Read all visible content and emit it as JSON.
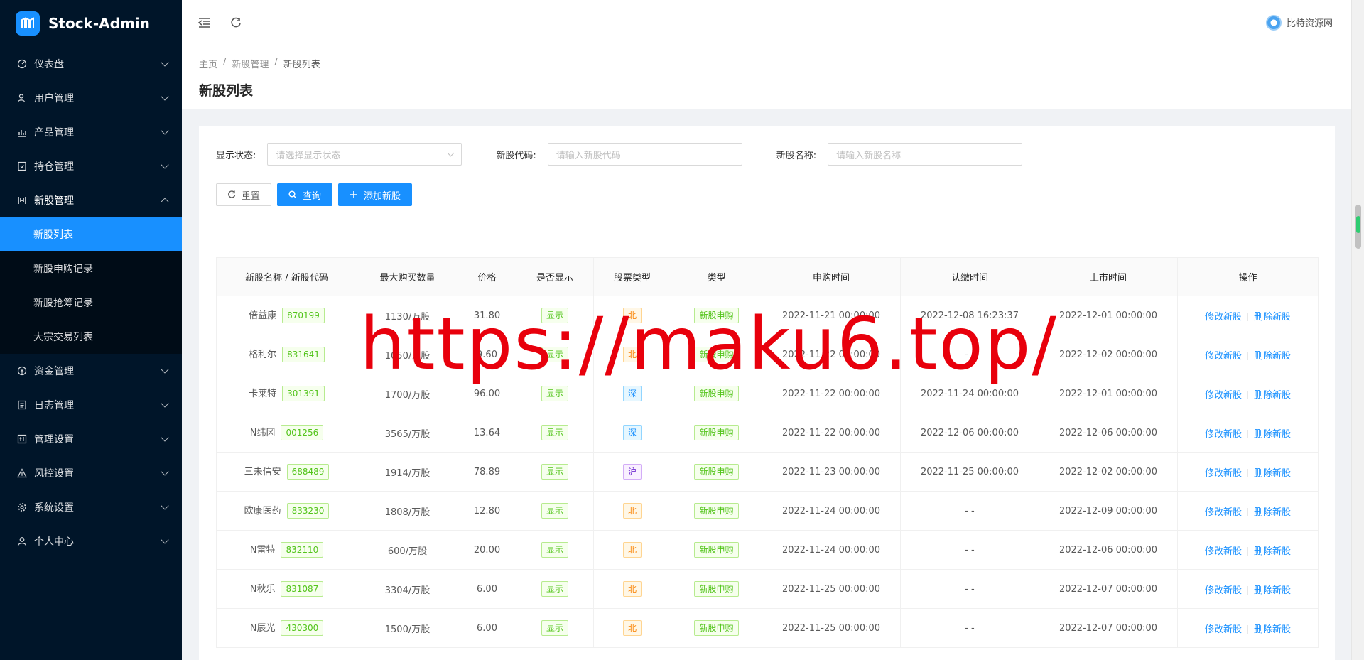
{
  "app": {
    "title": "Stock-Admin"
  },
  "sidebar": {
    "items": [
      {
        "label": "仪表盘",
        "icon": "dashboard-icon"
      },
      {
        "label": "用户管理",
        "icon": "user-manage-icon"
      },
      {
        "label": "产品管理",
        "icon": "chart-icon"
      },
      {
        "label": "持仓管理",
        "icon": "position-icon"
      },
      {
        "label": "新股管理",
        "icon": "ipo-icon",
        "open": true,
        "children": [
          "新股列表",
          "新股申购记录",
          "新股抢筹记录",
          "大宗交易列表"
        ]
      },
      {
        "label": "资金管理",
        "icon": "money-icon"
      },
      {
        "label": "日志管理",
        "icon": "log-icon"
      },
      {
        "label": "管理设置",
        "icon": "admin-settings-icon"
      },
      {
        "label": "风控设置",
        "icon": "warning-icon"
      },
      {
        "label": "系统设置",
        "icon": "gear-icon"
      },
      {
        "label": "个人中心",
        "icon": "person-icon"
      }
    ]
  },
  "header": {
    "user": "比特资源网"
  },
  "breadcrumb": {
    "home": "主页",
    "parent": "新股管理",
    "current": "新股列表"
  },
  "page": {
    "title": "新股列表"
  },
  "search": {
    "status_label": "显示状态:",
    "status_placeholder": "请选择显示状态",
    "code_label": "新股代码:",
    "code_placeholder": "请输入新股代码",
    "name_label": "新股名称:",
    "name_placeholder": "请输入新股名称"
  },
  "buttons": {
    "reset": "重置",
    "query": "查询",
    "add": "添加新股"
  },
  "table": {
    "headers": [
      "新股名称 / 新股代码",
      "最大购买数量",
      "价格",
      "是否显示",
      "股票类型",
      "类型",
      "申购时间",
      "认缴时间",
      "上市时间",
      "操作"
    ],
    "rows": [
      {
        "name": "倍益康",
        "code": "870199",
        "qty": "1130/万股",
        "price": "31.80",
        "show": "显示",
        "market": "北",
        "type": "新股申购",
        "apply": "2022-11-21 00:00:00",
        "pay": "2022-12-08 16:23:37",
        "list": "2022-12-01 00:00:00"
      },
      {
        "name": "格利尔",
        "code": "831641",
        "qty": "1050/万股",
        "price": "9.60",
        "show": "显示",
        "market": "北",
        "type": "新股申购",
        "apply": "2022-11-22 00:00:00",
        "pay": "- -",
        "list": "2022-12-02 00:00:00"
      },
      {
        "name": "卡莱特",
        "code": "301391",
        "qty": "1700/万股",
        "price": "96.00",
        "show": "显示",
        "market": "深",
        "type": "新股申购",
        "apply": "2022-11-22 00:00:00",
        "pay": "2022-11-24 00:00:00",
        "list": "2022-12-01 00:00:00"
      },
      {
        "name": "N纬冈",
        "code": "001256",
        "qty": "3565/万股",
        "price": "13.64",
        "show": "显示",
        "market": "深",
        "type": "新股申购",
        "apply": "2022-11-22 00:00:00",
        "pay": "2022-12-06 00:00:00",
        "list": "2022-12-06 00:00:00"
      },
      {
        "name": "三未信安",
        "code": "688489",
        "qty": "1914/万股",
        "price": "78.89",
        "show": "显示",
        "market": "沪",
        "type": "新股申购",
        "apply": "2022-11-23 00:00:00",
        "pay": "2022-11-25 00:00:00",
        "list": "2022-12-02 00:00:00"
      },
      {
        "name": "欧康医药",
        "code": "833230",
        "qty": "1808/万股",
        "price": "12.80",
        "show": "显示",
        "market": "北",
        "type": "新股申购",
        "apply": "2022-11-24 00:00:00",
        "pay": "- -",
        "list": "2022-12-09 00:00:00"
      },
      {
        "name": "N雷特",
        "code": "832110",
        "qty": "600/万股",
        "price": "20.00",
        "show": "显示",
        "market": "北",
        "type": "新股申购",
        "apply": "2022-11-24 00:00:00",
        "pay": "- -",
        "list": "2022-12-06 00:00:00"
      },
      {
        "name": "N秋乐",
        "code": "831087",
        "qty": "3304/万股",
        "price": "6.00",
        "show": "显示",
        "market": "北",
        "type": "新股申购",
        "apply": "2022-11-25 00:00:00",
        "pay": "- -",
        "list": "2022-12-07 00:00:00"
      },
      {
        "name": "N辰光",
        "code": "430300",
        "qty": "1500/万股",
        "price": "6.00",
        "show": "显示",
        "market": "北",
        "type": "新股申购",
        "apply": "2022-11-25 00:00:00",
        "pay": "- -",
        "list": "2022-12-07 00:00:00"
      }
    ],
    "ops": {
      "edit": "修改新股",
      "delete": "删除新股"
    }
  },
  "colors": {
    "primary": "#1890ff",
    "sidebar_bg": "#001529",
    "watermark": "#e8000c"
  },
  "watermark": "https://maku6.top/"
}
